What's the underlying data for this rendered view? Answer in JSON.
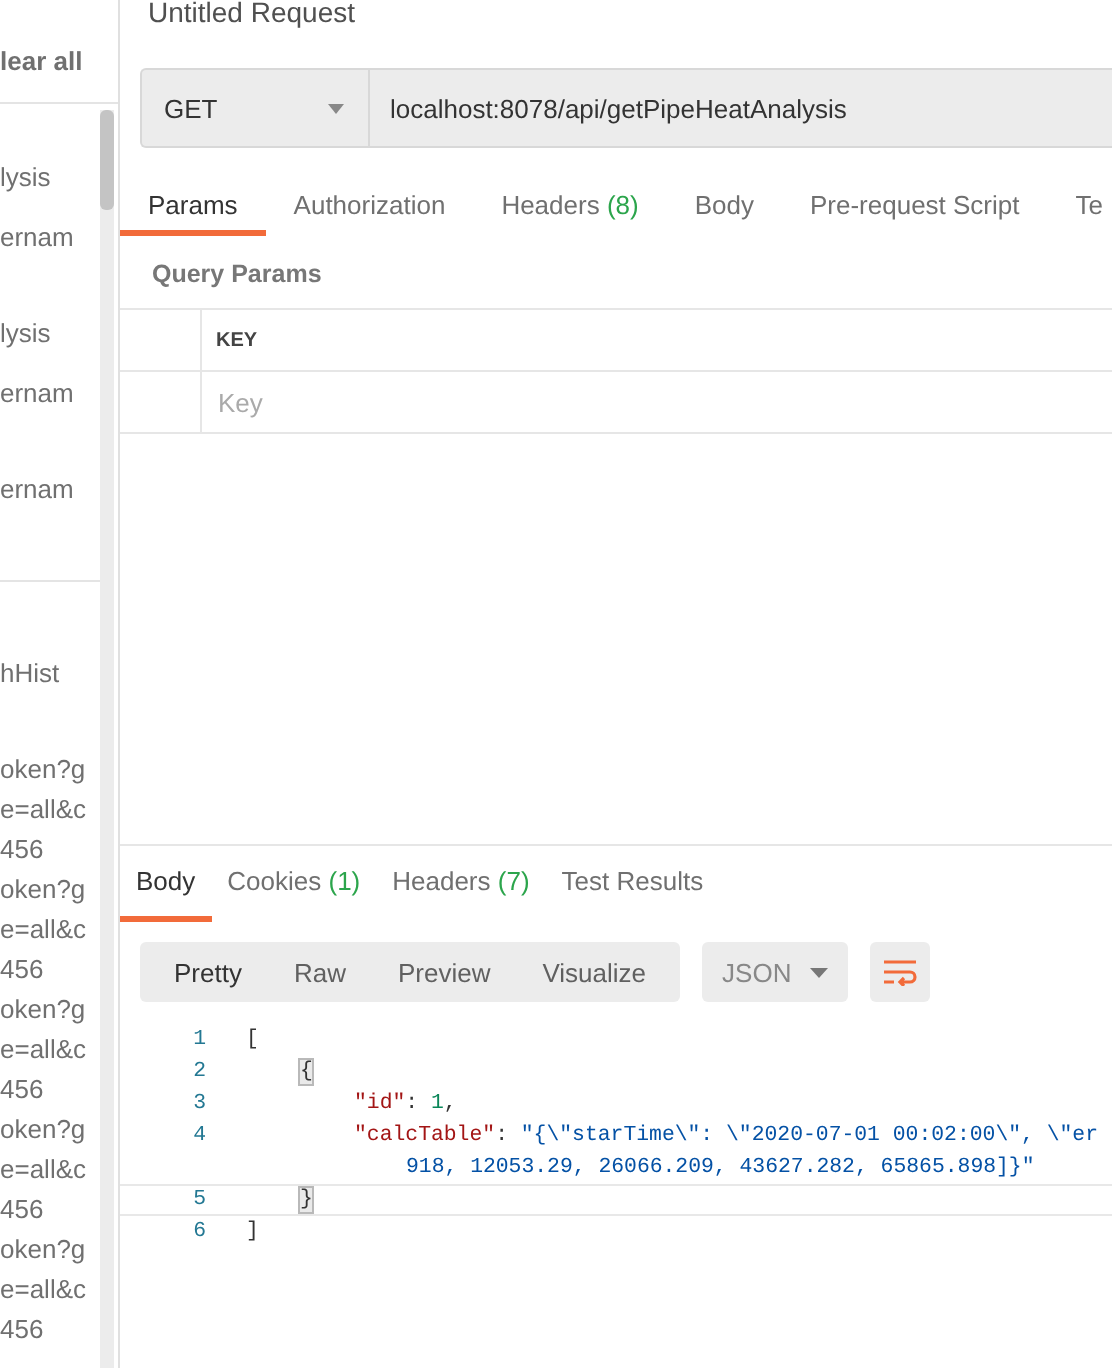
{
  "sidebar": {
    "clear_all": "lear all",
    "groups": [
      {
        "items": [
          {
            "lines": [
              "lysis",
              "ernam"
            ]
          },
          {
            "lines": [
              "lysis",
              "ernam"
            ]
          },
          {
            "lines": [
              "ernam"
            ]
          }
        ]
      },
      {
        "items": [
          {
            "lines": [
              "hHist"
            ]
          },
          {
            "lines": [
              "oken?g",
              "e=all&c",
              "456"
            ]
          },
          {
            "lines": [
              "oken?g",
              "e=all&c",
              "456"
            ]
          },
          {
            "lines": [
              "oken?g",
              "e=all&c",
              "456"
            ]
          },
          {
            "lines": [
              "oken?g",
              "e=all&c",
              "456"
            ]
          },
          {
            "lines": [
              "oken?g",
              "e=all&c",
              "456"
            ]
          }
        ]
      }
    ]
  },
  "request": {
    "title": "Untitled Request",
    "method": "GET",
    "url": "localhost:8078/api/getPipeHeatAnalysis",
    "tabs": [
      {
        "label": "Params",
        "selected": true
      },
      {
        "label": "Authorization",
        "selected": false
      },
      {
        "label": "Headers",
        "count": "(8)",
        "selected": false
      },
      {
        "label": "Body",
        "selected": false
      },
      {
        "label": "Pre-request Script",
        "selected": false
      },
      {
        "label": "Te",
        "selected": false
      }
    ],
    "query_params": {
      "title": "Query Params",
      "columns": [
        "KEY"
      ],
      "rows": [
        {
          "key_placeholder": "Key"
        }
      ]
    }
  },
  "response": {
    "tabs": [
      {
        "label": "Body",
        "selected": true
      },
      {
        "label": "Cookies",
        "count": "(1)",
        "selected": false
      },
      {
        "label": "Headers",
        "count": "(7)",
        "selected": false
      },
      {
        "label": "Test Results",
        "selected": false
      }
    ],
    "views": [
      {
        "label": "Pretty",
        "selected": true
      },
      {
        "label": "Raw",
        "selected": false
      },
      {
        "label": "Preview",
        "selected": false
      },
      {
        "label": "Visualize",
        "selected": false
      }
    ],
    "format": "JSON",
    "code_lines": [
      {
        "number": "1",
        "current": false,
        "tokens": [
          {
            "kind": "punct",
            "text": "["
          }
        ],
        "children": [
          {
            "number": "2",
            "current": false,
            "tokens": [
              {
                "kind": "match",
                "text": "{"
              }
            ],
            "children": [
              {
                "number": "3",
                "current": false,
                "tokens": [
                  {
                    "kind": "key",
                    "text": "\"id\""
                  },
                  {
                    "kind": "punct",
                    "text": ": "
                  },
                  {
                    "kind": "number",
                    "text": "1"
                  },
                  {
                    "kind": "punct",
                    "text": ","
                  }
                ]
              },
              {
                "number": "4",
                "current": false,
                "tokens": [
                  {
                    "kind": "key",
                    "text": "\"calcTable\""
                  },
                  {
                    "kind": "punct",
                    "text": ": "
                  },
                  {
                    "kind": "string",
                    "text": "\"{\\\"starTime\\\": \\\"2020-07-01 00:02:00\\\", \\\"er"
                  }
                ],
                "wrapped": "918, 12053.29, 26066.209, 43627.282, 65865.898]}\""
              }
            ]
          },
          {
            "number": "5",
            "current": true,
            "tokens": [
              {
                "kind": "match",
                "text": "}"
              }
            ]
          }
        ]
      },
      {
        "number": "6",
        "current": false,
        "tokens": [
          {
            "kind": "punct",
            "text": "]"
          }
        ]
      }
    ]
  }
}
